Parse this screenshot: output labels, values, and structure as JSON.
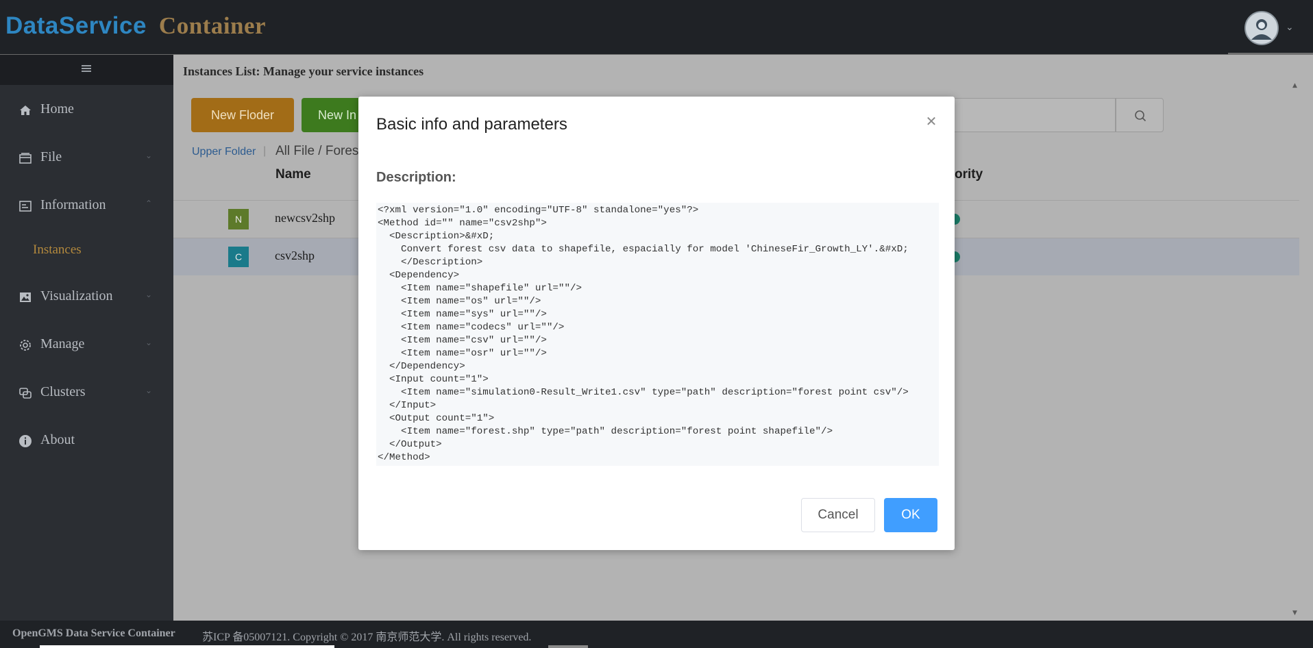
{
  "header": {
    "logo_part1": "DataService",
    "logo_part2": "Container",
    "user_menu_icon": "chevron-down-icon"
  },
  "sidebar": {
    "collapse_icon": "menu-icon",
    "items": [
      {
        "label": "Home",
        "icon": "home-icon"
      },
      {
        "label": "File",
        "icon": "folder-icon"
      },
      {
        "label": "Information",
        "icon": "info-card-icon"
      },
      {
        "label": "Visualization",
        "icon": "image-icon"
      },
      {
        "label": "Manage",
        "icon": "gear-icon"
      },
      {
        "label": "Clusters",
        "icon": "clusters-icon"
      },
      {
        "label": "About",
        "icon": "info-icon"
      }
    ],
    "sub_item": "Instances"
  },
  "main": {
    "title": "Instances List: Manage your service instances",
    "new_folder_label": "New Floder",
    "new_instance_label": "New In",
    "search_placeholder": "",
    "upper_folder": "Upper Folder",
    "separator": "|",
    "path": "All File / Forest",
    "columns": {
      "name": "Name",
      "authority": "ority"
    },
    "rows": [
      {
        "badge": "N",
        "name": "newcsv2shp",
        "badge_color": "#5d7a2a"
      },
      {
        "badge": "C",
        "name": "csv2shp",
        "badge_color": "#1a7a8a"
      }
    ]
  },
  "modal": {
    "title": "Basic info and parameters",
    "description_label": "Description:",
    "code": "<?xml version=\"1.0\" encoding=\"UTF-8\" standalone=\"yes\"?>\n<Method id=\"\" name=\"csv2shp\">\n  <Description>&#xD;\n    Convert forest csv data to shapefile, espacially for model 'ChineseFir_Growth_LY'.&#xD;\n    </Description>\n  <Dependency>\n    <Item name=\"shapefile\" url=\"\"/>\n    <Item name=\"os\" url=\"\"/>\n    <Item name=\"sys\" url=\"\"/>\n    <Item name=\"codecs\" url=\"\"/>\n    <Item name=\"csv\" url=\"\"/>\n    <Item name=\"osr\" url=\"\"/>\n  </Dependency>\n  <Input count=\"1\">\n    <Item name=\"simulation0-Result_Write1.csv\" type=\"path\" description=\"forest point csv\"/>\n  </Input>\n  <Output count=\"1\">\n    <Item name=\"forest.shp\" type=\"path\" description=\"forest point shapefile\"/>\n  </Output>\n</Method>",
    "cancel_label": "Cancel",
    "ok_label": "OK"
  },
  "footer": {
    "brand": "OpenGMS Data Service Container",
    "copyright": "苏ICP 备05007121. Copyright © 2017 南京师范大学. All rights reserved."
  },
  "colors": {
    "accent": "#409eff",
    "sidebar_active": "#b3893d",
    "new_folder": "#a26c17",
    "new_instance": "#3d7a1e"
  }
}
